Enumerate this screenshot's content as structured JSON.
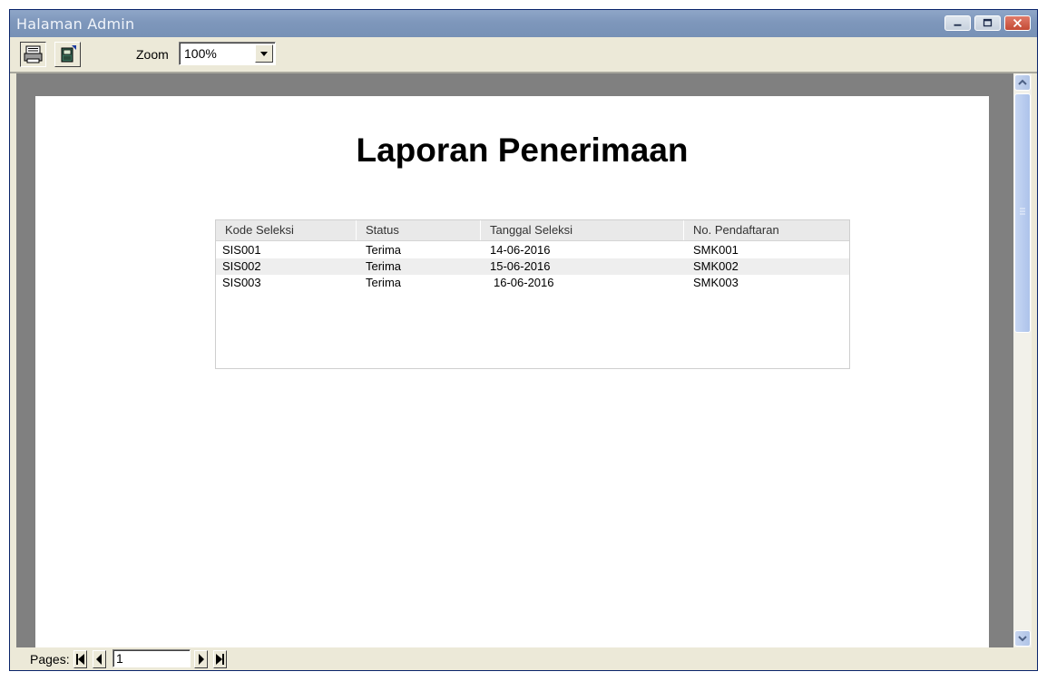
{
  "window": {
    "title": "Halaman Admin",
    "title_color": "#7e97bb"
  },
  "toolbar": {
    "print_icon": "printer-icon",
    "export_icon": "export-icon",
    "zoom_label": "Zoom",
    "zoom_value": "100%"
  },
  "report": {
    "title": "Laporan Penerimaan",
    "columns": [
      "Kode Seleksi",
      "Status",
      "Tanggal Seleksi",
      "No. Pendaftaran"
    ],
    "rows": [
      [
        "SIS001",
        "Terima",
        "14-06-2016",
        "SMK001"
      ],
      [
        "SIS002",
        "Terima",
        "15-06-2016",
        "SMK002"
      ],
      [
        "SIS003",
        "Terima",
        "16-06-2016",
        "SMK003"
      ]
    ]
  },
  "statusbar": {
    "pages_label": "Pages:",
    "page_number": "1"
  }
}
